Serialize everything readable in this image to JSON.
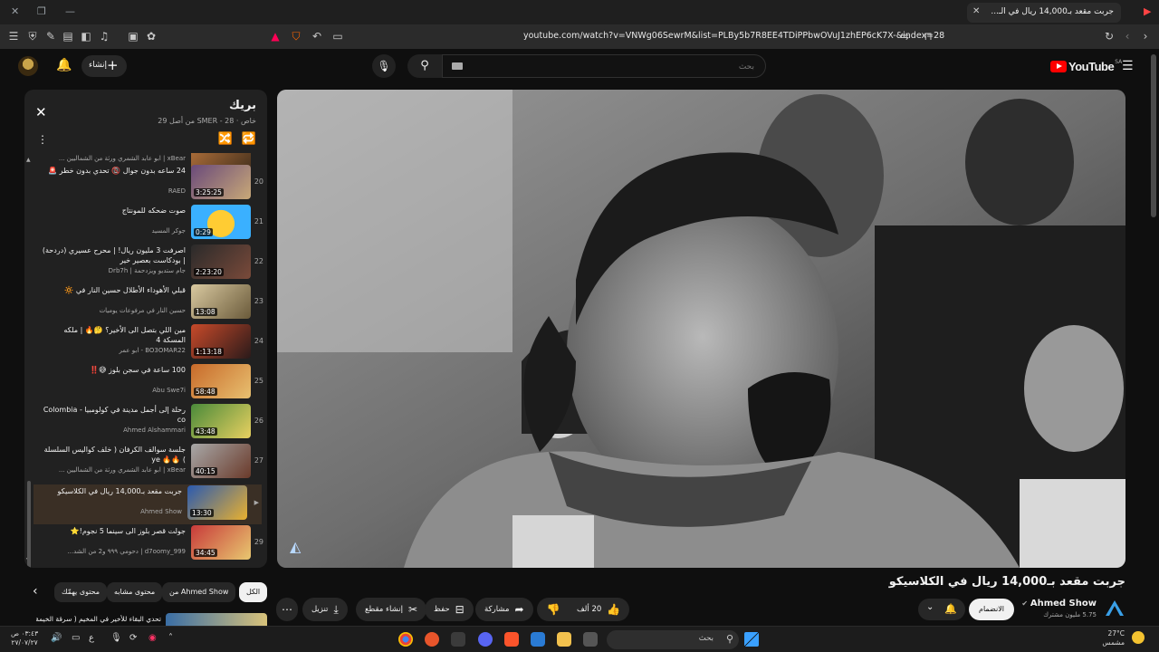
{
  "browser": {
    "tab_title": "جربت مقعد بـ14,000 ريال في الـ...",
    "url": "youtube.com/watch?v=VNWg06SewrM&list=PLBy5b7R8EE4TDiPPbwOVuJ1zhEP6cK7X-&index=28"
  },
  "header": {
    "create_label": "إنشاء",
    "search_placeholder": "بحث",
    "logo_text": "YouTube",
    "logo_country": "SA"
  },
  "playlist": {
    "title": "بريك",
    "subtitle": "خاص · SMER - 28 من أصل 29",
    "items": [
      {
        "index": "",
        "title": "",
        "channel": "xBear | ابو عابد الشمري ورثة من الشماليين ...",
        "duration": "",
        "active": false
      },
      {
        "index": "20",
        "title": "24 ساعه بدون جوال 📵 تحدي بدون خطر 🚨",
        "channel": "RAED",
        "duration": "3:25:25",
        "active": false
      },
      {
        "index": "21",
        "title": "صوت ضحكه للمونتاج",
        "channel": "جوكر المسيد",
        "duration": "0:29",
        "active": false
      },
      {
        "index": "22",
        "title": "اصرفت 3 مليون ريال! | محرح عسيري (دردحة) | بودكاست بعصير خير",
        "channel": "جام ستديو ويزدحمة | Drb7h",
        "duration": "2:23:20",
        "active": false
      },
      {
        "index": "23",
        "title": "قبلي الأهوداء الأطلال حسين النار في 🔆",
        "channel": "حسين النار في مرفوعات يوميات",
        "duration": "13:08",
        "active": false
      },
      {
        "index": "24",
        "title": "مين اللي بتصل الى الأخير؟ 🤔🔥 | ملكه المسكة 4",
        "channel": "BO3OMAR22 - ابو عمر",
        "duration": "1:13:18",
        "active": false
      },
      {
        "index": "25",
        "title": "100 ساعة في سجن بلوز 😅‼️",
        "channel": "Abu Swe7i",
        "duration": "58:48",
        "active": false
      },
      {
        "index": "26",
        "title": "رحلة إلى أجمل مدينة في كولومبيا - Colombia co",
        "channel": "Ahmed Alshammari",
        "duration": "43:48",
        "active": false
      },
      {
        "index": "27",
        "title": "جلسة سوالف الكرفان ( خلف كواليس السلسلة ) 🔥🔥 ye",
        "channel": "xBear | ابو عابد الشمري ورثة من الشماليين ...",
        "duration": "40:15",
        "active": false
      },
      {
        "index": "",
        "title": "جربت مقعد بـ14,000 ريال في الكلاسيكو",
        "channel": "Ahmed Show",
        "duration": "13:30",
        "active": true
      },
      {
        "index": "29",
        "title": "جولت قصر بلوز الى سينما 5 نجوم!⭐",
        "channel": "d7oomy_999 | دحومي ٩٩٩ و2 من الشد...",
        "duration": "34:45",
        "active": false
      }
    ]
  },
  "video": {
    "title": "جربت مقعد بـ14,000 ريال في الكلاسيكو",
    "channel_name": "Ahmed Show",
    "channel_subs": "5.75 مليون مشترك",
    "join_label": "الانضمام",
    "likes": "20 ألف",
    "share_label": "مشاركة",
    "save_label": "حفظ",
    "clip_label": "إنشاء مقطع",
    "download_label": "تنزيل"
  },
  "chips": {
    "all": "الكل",
    "from_channel": "من Ahmed Show",
    "similar": "محتوى مشابه",
    "for_you": "محتوى يهمّك"
  },
  "next_up": {
    "title": "تحدي البقاء للأخير في المخيم ( سرقة الخيمة )"
  },
  "taskbar": {
    "search_label": "بحث",
    "time": "٠٣:٤٣ ص",
    "date": "٢٧/٠٧/٢٧",
    "temperature": "27°C",
    "weather_text": "مشمس",
    "lang": "ع"
  }
}
